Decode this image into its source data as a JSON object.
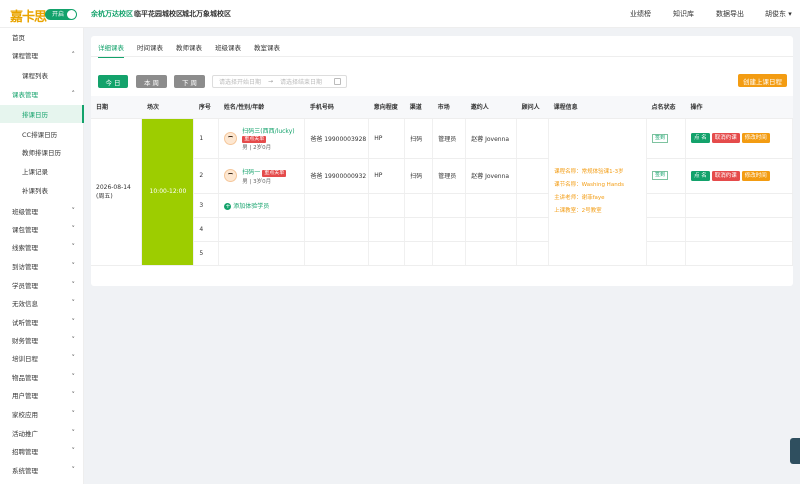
{
  "brand": {
    "logo": "嘉卡思",
    "toggle_label": "开启"
  },
  "campuses": [
    "余杭万达校区",
    "临平花园城校区",
    "城北万象城校区"
  ],
  "topnav": [
    "业绩榜",
    "知识库",
    "数据导出",
    "胡俊东"
  ],
  "sidebar": [
    {
      "label": "首页",
      "expandable": false
    },
    {
      "label": "课程管理",
      "expandable": true,
      "open": true
    },
    {
      "label": "课程列表",
      "sub": true
    },
    {
      "label": "课表管理",
      "expandable": true,
      "open": true
    },
    {
      "label": "排课日历",
      "sub": true,
      "active": true
    },
    {
      "label": "CC排课日历",
      "sub": true
    },
    {
      "label": "教师排课日历",
      "sub": true
    },
    {
      "label": "上课记录",
      "sub": true
    },
    {
      "label": "补课列表",
      "sub": true
    },
    {
      "label": "班级管理",
      "expandable": true
    },
    {
      "label": "课包管理",
      "expandable": true
    },
    {
      "label": "线索管理",
      "expandable": true
    },
    {
      "label": "到访管理",
      "expandable": true
    },
    {
      "label": "学员管理",
      "expandable": true
    },
    {
      "label": "无效信息",
      "expandable": true
    },
    {
      "label": "试听管理",
      "expandable": true
    },
    {
      "label": "财务管理",
      "expandable": true
    },
    {
      "label": "培训日程",
      "expandable": true
    },
    {
      "label": "物品管理",
      "expandable": true
    },
    {
      "label": "用户管理",
      "expandable": true
    },
    {
      "label": "家校应用",
      "expandable": true
    },
    {
      "label": "活动推广",
      "expandable": true
    },
    {
      "label": "招聘管理",
      "expandable": true
    },
    {
      "label": "系统管理",
      "expandable": true
    }
  ],
  "tabs": [
    "详细课表",
    "时间课表",
    "教师课表",
    "班级课表",
    "教室课表"
  ],
  "toolbar": {
    "today": "今 日",
    "week": "本 周",
    "next": "下 周",
    "start_placeholder": "请选择开始日期",
    "end_placeholder": "请选择结束日期",
    "create": "创建上课日程"
  },
  "table": {
    "headers": [
      "日期",
      "场次",
      "序号",
      "姓名/性别/年龄",
      "手机号码",
      "意向程度",
      "渠道",
      "市场",
      "邀约人",
      "顾问人",
      "课程信息",
      "点名状态",
      "操作"
    ],
    "date": "2026-08-14",
    "weekday": "(周五)",
    "slot": "10:00-12:00",
    "rows": [
      {
        "no": "1",
        "name": "扫码三(西西/lucky)",
        "tag": "重点关单",
        "meta": "男 | 2岁0月",
        "phone": "爸爸 19900003928",
        "intent": "HP",
        "channel": "扫码",
        "market": "管理员",
        "inviter": "赵蓉 Jovenna",
        "status": "签到",
        "ops": [
          "点 名",
          "取消约课",
          "修改时间"
        ]
      },
      {
        "no": "2",
        "name": "扫码一",
        "tag": "重点关单",
        "meta": "男 | 3岁0月",
        "phone": "爸爸 19900000932",
        "intent": "HP",
        "channel": "扫码",
        "market": "管理员",
        "inviter": "赵蓉 Jovenna",
        "status": "签到",
        "ops": [
          "点 名",
          "取消约课",
          "修改时间"
        ]
      },
      {
        "no": "3",
        "add": "添加体验学员"
      },
      {
        "no": "4"
      },
      {
        "no": "5"
      }
    ],
    "course_info": [
      "课程名称：常规体验课1-3岁",
      "课节名称：Washing Hands",
      "主讲老师：谢菲faye",
      "上课教室：2号教室"
    ]
  },
  "colors": {
    "accent": "#13a26b",
    "slot": "#9dcd00",
    "orange": "#f39c12",
    "danger": "#e54b4b"
  }
}
